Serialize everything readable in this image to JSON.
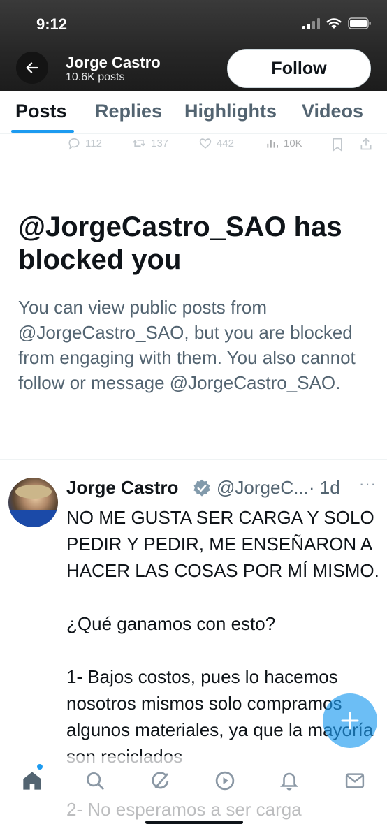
{
  "status_bar": {
    "time": "9:12"
  },
  "header": {
    "name": "Jorge Castro",
    "posts_count": "10.6K posts",
    "follow_label": "Follow"
  },
  "tabs": [
    {
      "label": "Posts",
      "active": true
    },
    {
      "label": "Replies",
      "active": false
    },
    {
      "label": "Highlights",
      "active": false
    },
    {
      "label": "Videos",
      "active": false
    }
  ],
  "faded_actions": {
    "replies": "112",
    "reposts": "137",
    "likes": "442",
    "views": "10K"
  },
  "blocked": {
    "title": "@JorgeCastro_SAO has blocked you",
    "body": "You can view public posts from @JorgeCastro_SAO, but you are blocked from engaging with them. You also cannot follow or message @JorgeCastro_SAO."
  },
  "tweet": {
    "name": "Jorge Castro",
    "handle": "@JorgeC...",
    "time": "· 1d",
    "more": "···",
    "text": "NO ME GUSTA SER CARGA Y SOLO PEDIR Y PEDIR, ME ENSEÑARON A HACER LAS COSAS POR MÍ MISMO.\n\n¿Qué ganamos con esto?\n\n1- Bajos costos, pues lo hacemos nosotros mismos solo compramos algunos materiales, ya que la mayoría son reciclados\n\n2- No esperamos a ser carga"
  },
  "colors": {
    "accent": "#1d9bf0",
    "text_primary": "#0f1419",
    "text_secondary": "#536471"
  },
  "icons": {
    "back": "arrow-left-icon",
    "fab": "plus-icon",
    "nav": [
      "home-icon",
      "search-icon",
      "grok-icon",
      "video-icon",
      "notifications-icon",
      "messages-icon"
    ]
  }
}
